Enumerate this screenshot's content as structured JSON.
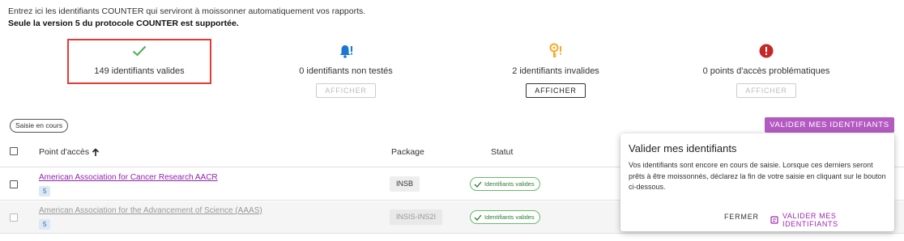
{
  "intro": {
    "line1": "Entrez ici les identifiants COUNTER qui serviront à moissonner automatiquement vos rapports.",
    "line2": "Seule la version 5 du protocole COUNTER est supportée."
  },
  "stats": [
    {
      "label": "149 identifiants valides",
      "icon": "check-icon",
      "color": "#4caf50"
    },
    {
      "label": "0 identifiants non testés",
      "icon": "bell-alert-icon",
      "color": "#1976d2",
      "button": "AFFICHER",
      "button_enabled": false
    },
    {
      "label": "2 identifiants invalides",
      "icon": "key-alert-icon",
      "color": "#f9a825",
      "button": "AFFICHER",
      "button_enabled": true
    },
    {
      "label": "0 points d'accès problématiques",
      "icon": "error-circle-icon",
      "color": "#c62828",
      "button": "AFFICHER",
      "button_enabled": false
    }
  ],
  "chip": "Saisie en cours",
  "validate_button": "VALIDER MES IDENTIFIANTS",
  "table": {
    "headers": {
      "access_point": "Point d'accès",
      "package": "Package",
      "status": "Statut"
    },
    "rows": [
      {
        "name": "American Association for Cancer Research AACR",
        "tag": "5",
        "package": "INSB",
        "status": "Identifiants valides",
        "dimmed": false
      },
      {
        "name": "American Association for the Advancement of Science (AAAS)",
        "tag": "5",
        "package": "INSIS-INS2I",
        "status": "Identifiants valides",
        "dimmed": true
      }
    ]
  },
  "popover": {
    "title": "Valider mes identifiants",
    "body": "Vos identifiants sont encore en cours de saisie. Lorsque ces derniers seront prêts à être moissonnés, déclarez la fin de votre saisie en cliquant sur le bouton ci-dessous.",
    "close": "FERMER",
    "confirm": "VALIDER MES IDENTIFIANTS"
  },
  "colors": {
    "accent": "#b35bc1",
    "highlight": "#e53935",
    "link": "#8e24aa"
  }
}
